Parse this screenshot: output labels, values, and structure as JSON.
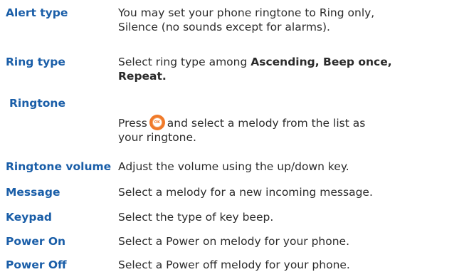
{
  "rows": [
    {
      "term": "Alert type",
      "line1": "You may set your phone ringtone to Ring only,",
      "line2": "Silence (no sounds except for alarms)."
    },
    {
      "term": "Ring type",
      "line1_prefix": "Select ring type among ",
      "line1_bold": "Ascending, Beep once,",
      "line2_bold": "Repeat."
    },
    {
      "term": "Ringtone",
      "line1_prefix": "Press",
      "line1_suffix": "and select a melody from the list as",
      "line2": "your ringtone.",
      "key_label": "OK"
    },
    {
      "term": "Ringtone volume",
      "line1": "Adjust the volume using the up/down key."
    },
    {
      "term": "Message",
      "line1": "Select a melody for a new incoming message."
    },
    {
      "term": "Keypad",
      "line1": "Select the type of key beep."
    },
    {
      "term": "Power On",
      "line1": "Select a Power on melody for your phone."
    },
    {
      "term": "Power Off",
      "line1": "Select a Power off melody for your phone."
    }
  ],
  "colors": {
    "term": "#1a5ea8",
    "text": "#2b2b2b",
    "ok_key": "#f07a2a"
  }
}
